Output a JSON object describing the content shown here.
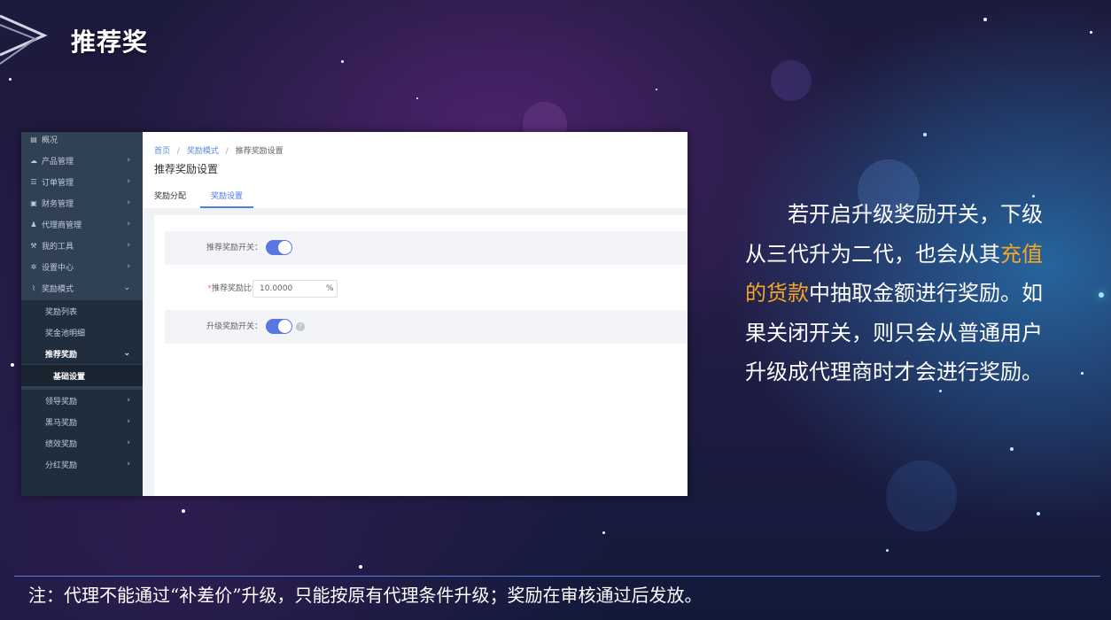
{
  "slide": {
    "title": "推荐奖",
    "description_parts": {
      "p1": "若开启升级奖励开关，下级从三代升为二代，也会从其",
      "highlight": "充值的货款",
      "p2": "中抽取金额进行奖励。如果关闭开关，则只会从普通用户升级成代理商时才会进行奖励。"
    },
    "footer_note": "注：代理不能通过“补差价”升级，只能按原有代理条件升级；奖励在审核通过后发放。",
    "colors": {
      "highlight": "#f5a623",
      "accent": "#4a7be8",
      "switch": "#5a76e0"
    }
  },
  "sidebar": {
    "items": [
      {
        "label": "概况",
        "icon": "overview-icon",
        "glyph": "▤"
      },
      {
        "label": "产品管理",
        "icon": "cloud-icon",
        "glyph": "☁"
      },
      {
        "label": "订单管理",
        "icon": "list-icon",
        "glyph": "☰"
      },
      {
        "label": "财务管理",
        "icon": "money-icon",
        "glyph": "▣"
      },
      {
        "label": "代理商管理",
        "icon": "people-icon",
        "glyph": "♟"
      },
      {
        "label": "我的工具",
        "icon": "hammer-icon",
        "glyph": "⚒"
      },
      {
        "label": "设置中心",
        "icon": "gear-icon",
        "glyph": "✲"
      },
      {
        "label": "奖励模式",
        "icon": "chart-icon",
        "glyph": "⌇"
      }
    ],
    "sub_items": [
      {
        "label": "奖励列表"
      },
      {
        "label": "奖金池明细"
      },
      {
        "label": "推荐奖励"
      },
      {
        "label": "基础设置"
      },
      {
        "label": "领导奖励"
      },
      {
        "label": "黑马奖励"
      },
      {
        "label": "绩效奖励"
      },
      {
        "label": "分红奖励"
      }
    ]
  },
  "breadcrumb": {
    "home": "首页",
    "section": "奖励模式",
    "current": "推荐奖励设置"
  },
  "main": {
    "title": "推荐奖励设置",
    "tabs": [
      "奖励分配",
      "奖励设置"
    ],
    "form": {
      "referral_switch_label": "推荐奖励开关：",
      "referral_switch_on": true,
      "ratio_label": "推荐奖励比例:",
      "ratio_required_mark": "*",
      "ratio_value": "10.0000",
      "ratio_suffix": "%",
      "upgrade_switch_label": "升级奖励开关：",
      "upgrade_switch_on": true,
      "help_glyph": "?"
    }
  }
}
